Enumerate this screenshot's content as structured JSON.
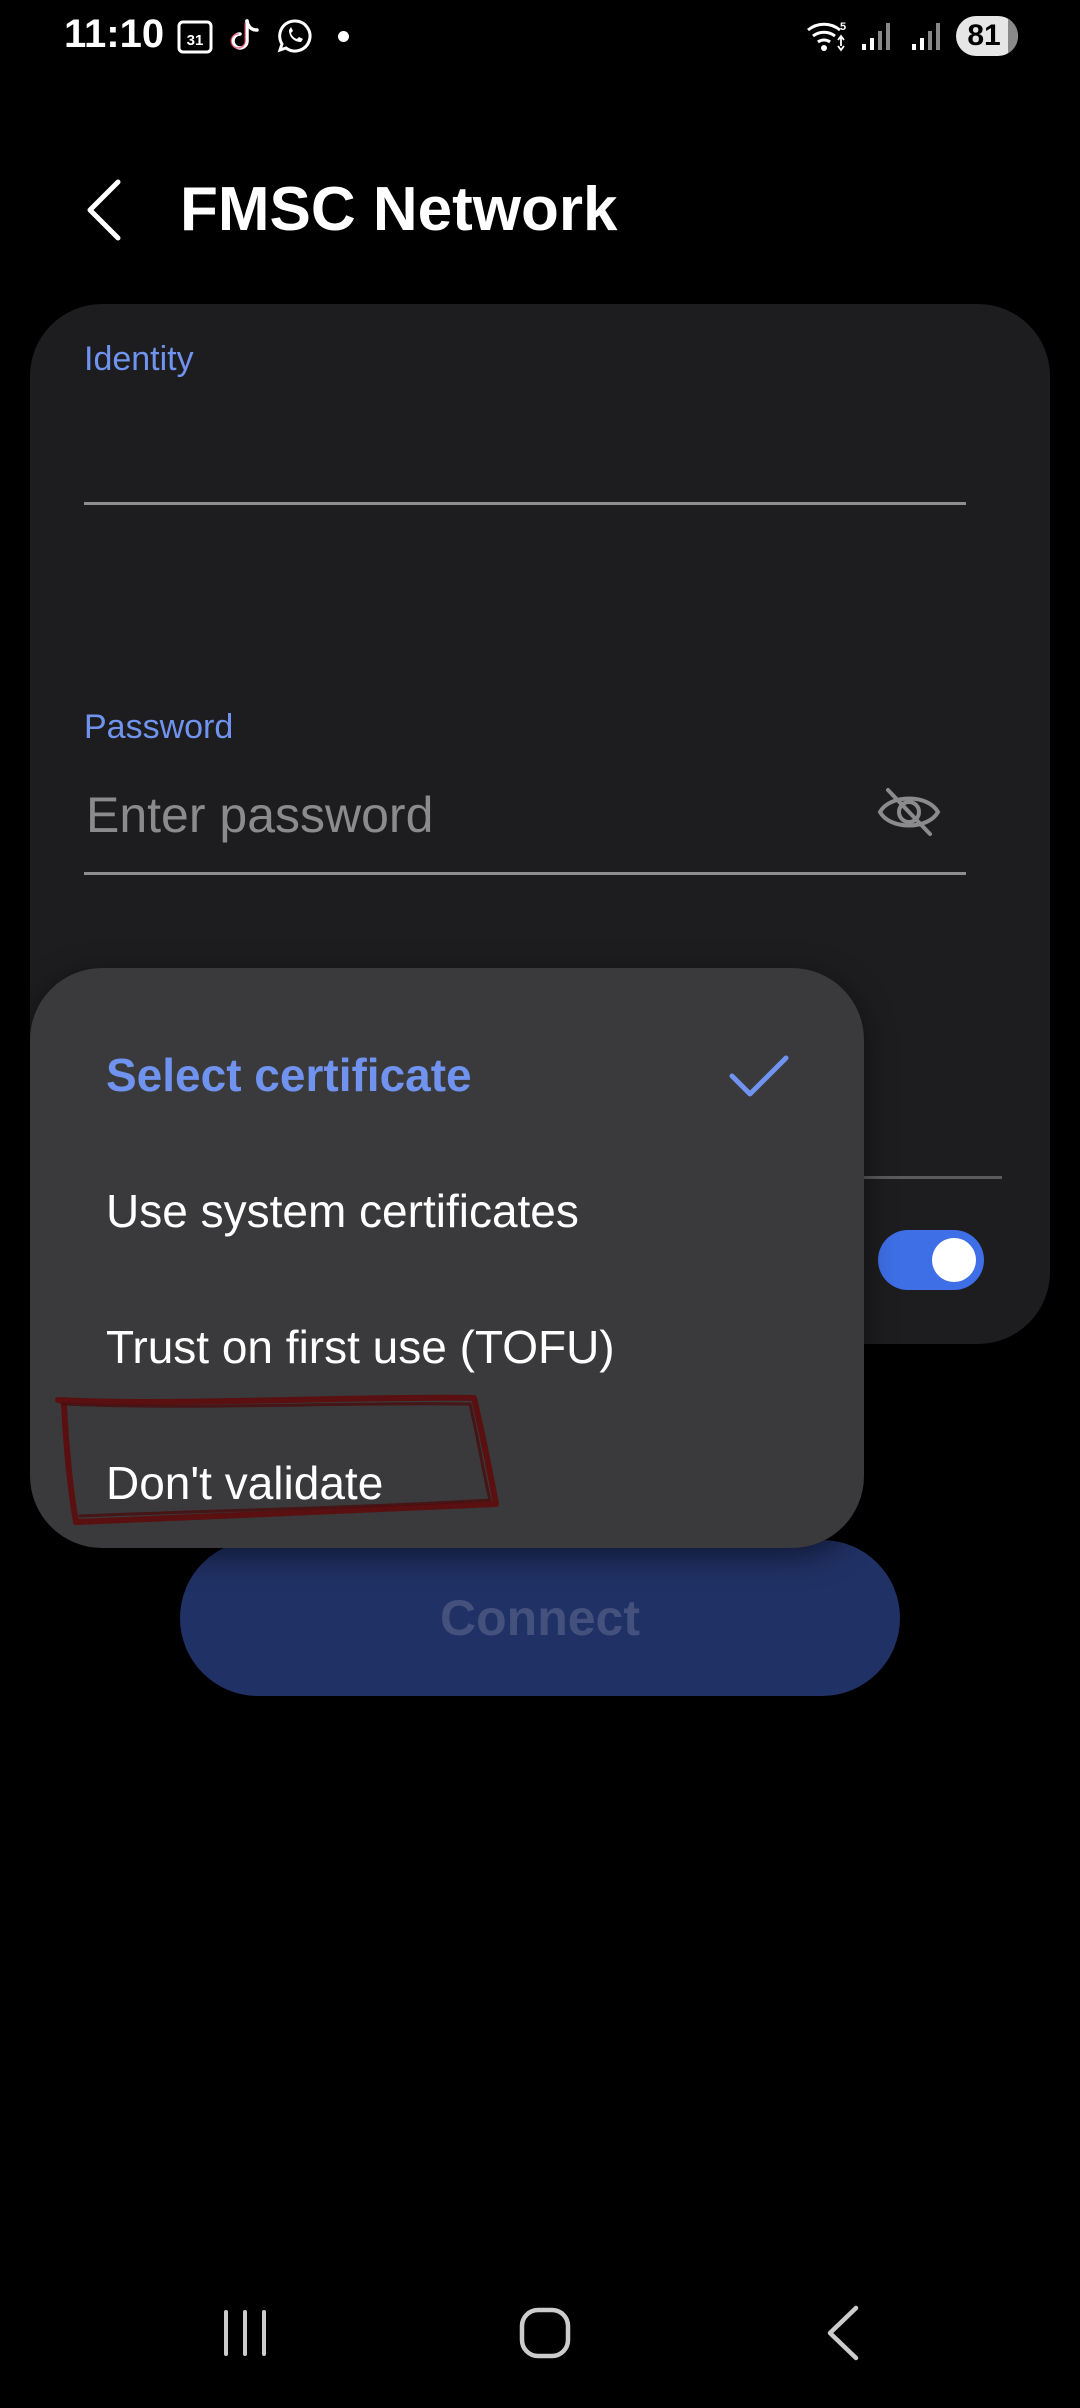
{
  "status_bar": {
    "time": "11:10",
    "calendar_badge": "31",
    "wifi_badge": "5",
    "battery": "81"
  },
  "header": {
    "title": "FMSC Network"
  },
  "form": {
    "identity_label": "Identity",
    "identity_value": "",
    "password_label": "Password",
    "password_placeholder": "Enter password"
  },
  "certificate_menu": {
    "items": [
      {
        "label": "Select certificate",
        "selected": true
      },
      {
        "label": "Use system certificates",
        "selected": false
      },
      {
        "label": "Trust on first use (TOFU)",
        "selected": false
      },
      {
        "label": "Don't validate",
        "selected": false
      }
    ]
  },
  "connect_button": {
    "label": "Connect"
  },
  "colors": {
    "accent": "#6f93ee",
    "toggle_on": "#3e6fe6",
    "card": "#1d1d1f",
    "menu": "#3a3a3c",
    "annotation": "#5a1010"
  },
  "icons": [
    "back-arrow-icon",
    "eye-off-icon",
    "checkmark-icon",
    "recents-icon",
    "home-icon",
    "nav-back-icon"
  ]
}
